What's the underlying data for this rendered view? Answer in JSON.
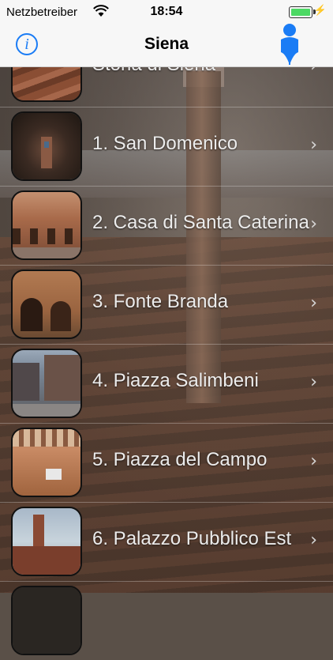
{
  "status_bar": {
    "carrier": "Netzbetreiber",
    "time": "18:54"
  },
  "nav": {
    "title": "Siena",
    "info_glyph": "i",
    "left_icon": "info-icon",
    "right_icon": "map-pin-icon",
    "accent_color": "#1a7cf5"
  },
  "list": {
    "items": [
      {
        "label": "Storia di Siena",
        "thumb": "storia"
      },
      {
        "label": "1. San Domenico",
        "thumb": "san-domenico"
      },
      {
        "label": "2. Casa di Santa Caterina",
        "thumb": "casa-caterina"
      },
      {
        "label": "3. Fonte Branda",
        "thumb": "fonte-branda"
      },
      {
        "label": "4. Piazza Salimbeni",
        "thumb": "piazza-salimbeni"
      },
      {
        "label": "5. Piazza del Campo",
        "thumb": "piazza-campo"
      },
      {
        "label": "6. Palazzo Pubblico Est",
        "thumb": "palazzo-pubblico"
      }
    ],
    "chevron_glyph": "›"
  }
}
